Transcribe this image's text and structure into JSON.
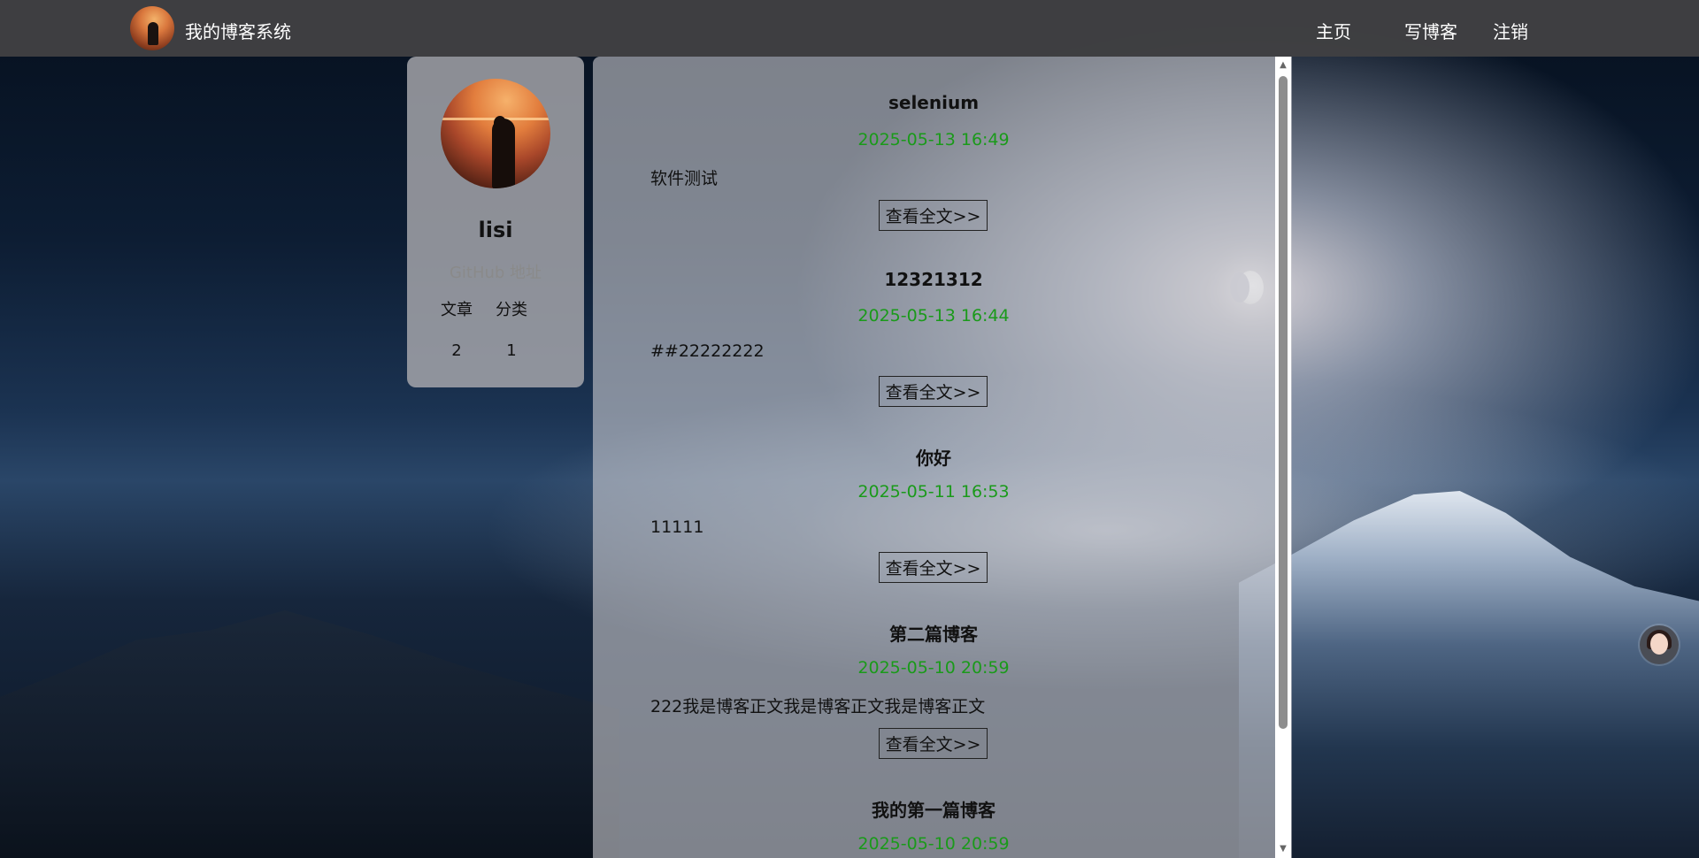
{
  "header": {
    "site_title": "我的博客系统",
    "nav": {
      "home": "主页",
      "write": "写博客",
      "logout": "注销"
    }
  },
  "profile": {
    "username": "lisi",
    "github_link": "GitHub 地址",
    "stats": {
      "articles_label": "文章",
      "categories_label": "分类",
      "articles_count": "2",
      "categories_count": "1"
    }
  },
  "posts": [
    {
      "title": "selenium",
      "date": "2025-05-13 16:49",
      "summary": "软件测试",
      "button": "查看全文>>"
    },
    {
      "title": "12321312",
      "date": "2025-05-13 16:44",
      "summary": "##22222222",
      "button": "查看全文>>"
    },
    {
      "title": "你好",
      "date": "2025-05-11 16:53",
      "summary": "11111",
      "button": "查看全文>>"
    },
    {
      "title": "第二篇博客",
      "date": "2025-05-10 20:59",
      "summary": "222我是博客正文我是博客正文我是博客正文",
      "button": "查看全文>>"
    },
    {
      "title": "我的第一篇博客",
      "date": "2025-05-10 20:59",
      "summary": "",
      "button": ""
    }
  ],
  "colors": {
    "date_green": "#1a9a1a",
    "header_bg": "#404042"
  },
  "icons": {
    "scroll_up": "scroll-up-arrow-icon",
    "scroll_down": "scroll-down-arrow-icon"
  }
}
